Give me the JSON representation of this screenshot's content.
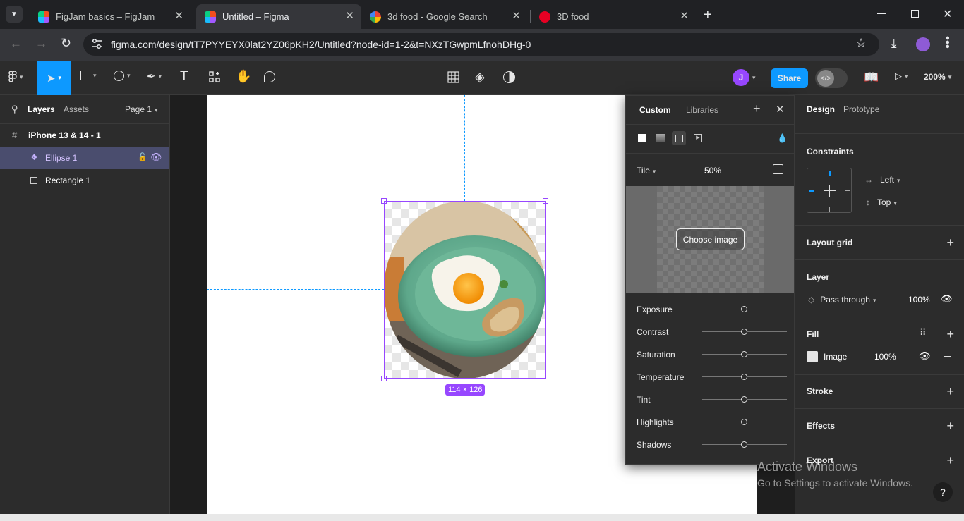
{
  "browser": {
    "tabs": [
      {
        "label": "FigJam basics – FigJam",
        "icon": "figma-icon"
      },
      {
        "label": "Untitled – Figma",
        "icon": "figma-icon",
        "active": true
      },
      {
        "label": "3d food - Google Search",
        "icon": "google-icon"
      },
      {
        "label": "3D food",
        "icon": "pinterest-icon"
      }
    ],
    "url": "figma.com/design/tT7PYYEYX0lat2YZ06pKH2/Untitled?node-id=1-2&t=NXzTGwpmLfnohDHg-0"
  },
  "figma_toolbar": {
    "avatar_initial": "J",
    "share_label": "Share",
    "zoom": "200%"
  },
  "left_panel": {
    "tabs": [
      "Layers",
      "Assets"
    ],
    "page": "Page 1",
    "layers": [
      {
        "label": "iPhone 13 & 14 - 1",
        "icon": "frame-icon",
        "bold": true
      },
      {
        "label": "Ellipse 1",
        "icon": "component-icon",
        "selected": true
      },
      {
        "label": "Rectangle 1",
        "icon": "rectangle-icon"
      }
    ]
  },
  "canvas": {
    "size_badge": "114 × 126"
  },
  "image_popup": {
    "tabs": [
      "Custom",
      "Libraries"
    ],
    "mode": "Tile",
    "scale": "50%",
    "choose_image_label": "Choose image",
    "adjustments": [
      {
        "label": "Exposure",
        "value": 0.5
      },
      {
        "label": "Contrast",
        "value": 0.5
      },
      {
        "label": "Saturation",
        "value": 0.5
      },
      {
        "label": "Temperature",
        "value": 0.5
      },
      {
        "label": "Tint",
        "value": 0.5
      },
      {
        "label": "Highlights",
        "value": 0.5
      },
      {
        "label": "Shadows",
        "value": 0.5
      }
    ]
  },
  "right_panel": {
    "tabs": [
      "Design",
      "Prototype"
    ],
    "constraints": {
      "title": "Constraints",
      "horizontal": "Left",
      "vertical": "Top"
    },
    "layout_grid": "Layout grid",
    "layer": {
      "title": "Layer",
      "blend": "Pass through",
      "opacity": "100%"
    },
    "fill": {
      "title": "Fill",
      "type": "Image",
      "opacity": "100%"
    },
    "stroke": "Stroke",
    "effects": "Effects",
    "export": "Export"
  },
  "watermark": {
    "line1": "Activate Windows",
    "line2": "Go to Settings to activate Windows."
  },
  "help_label": "?",
  "colors": {
    "accent": "#0d99ff",
    "selection": "#9747ff",
    "avatar": "#9747ff"
  }
}
